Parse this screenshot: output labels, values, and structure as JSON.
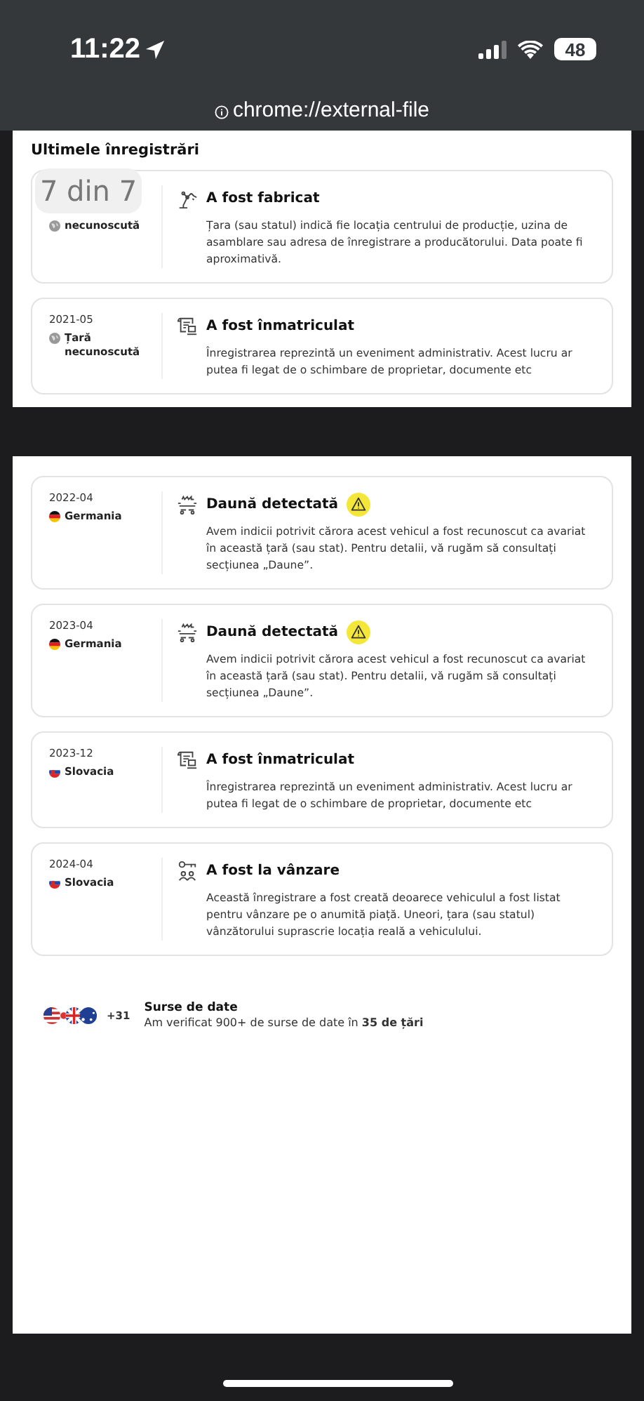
{
  "status_bar": {
    "time": "11:22",
    "battery": "48"
  },
  "address_bar": {
    "url": "chrome://external-file"
  },
  "section": {
    "title": "Ultimele înregistrări",
    "counter": "7 din 7"
  },
  "records_top": [
    {
      "country": "necunoscută",
      "flag": {
        "kind": "unknown"
      },
      "kind": "manufactured",
      "title": "A fost fabricat",
      "description": "Țara (sau statul) indică fie locația centrului de producție, uzina de asamblare sau adresa de înregistrare a producătorului. Data poate fi aproximativă.",
      "warning": false
    },
    {
      "date": "2021-05",
      "country": "Țară necunoscută",
      "flag": {
        "kind": "unknown"
      },
      "kind": "registered",
      "title": "A fost înmatriculat",
      "description": "Înregistrarea reprezintă un eveniment administrativ. Acest lucru ar putea fi legat de o schimbare de proprietar, documente etc",
      "warning": false
    }
  ],
  "records": [
    {
      "date": "2022-04",
      "country": "Germania",
      "flag": {
        "kind": "de"
      },
      "kind": "damage",
      "title": "Daună detectată",
      "description": "Avem indicii potrivit cărora acest vehicul a fost recunoscut ca avariat în această țară (sau stat). Pentru detalii, vă rugăm să consultați secțiunea „Daune”.",
      "warning": true
    },
    {
      "date": "2023-04",
      "country": "Germania",
      "flag": {
        "kind": "de"
      },
      "kind": "damage",
      "title": "Daună detectată",
      "description": "Avem indicii potrivit cărora acest vehicul a fost recunoscut ca avariat în această țară (sau stat). Pentru detalii, vă rugăm să consultați secțiunea „Daune”.",
      "warning": true
    },
    {
      "date": "2023-12",
      "country": "Slovacia",
      "flag": {
        "kind": "sk"
      },
      "kind": "registered",
      "title": "A fost înmatriculat",
      "description": "Înregistrarea reprezintă un eveniment administrativ. Acest lucru ar putea fi legat de o schimbare de proprietar, documente etc",
      "warning": false
    },
    {
      "date": "2024-04",
      "country": "Slovacia",
      "flag": {
        "kind": "sk"
      },
      "kind": "sale",
      "title": "A fost la vânzare",
      "description": "Această înregistrare a fost creată deoarece vehiculul a fost listat pentru vânzare pe o anumită piață. Uneori, țara (sau statul) vânzătorului suprascrie locația reală a vehiculului.",
      "warning": false
    }
  ],
  "sources": {
    "more_count": "+31",
    "title": "Surse de date",
    "description": "Am verificat 900+ de surse de date în **35 de țări**"
  }
}
